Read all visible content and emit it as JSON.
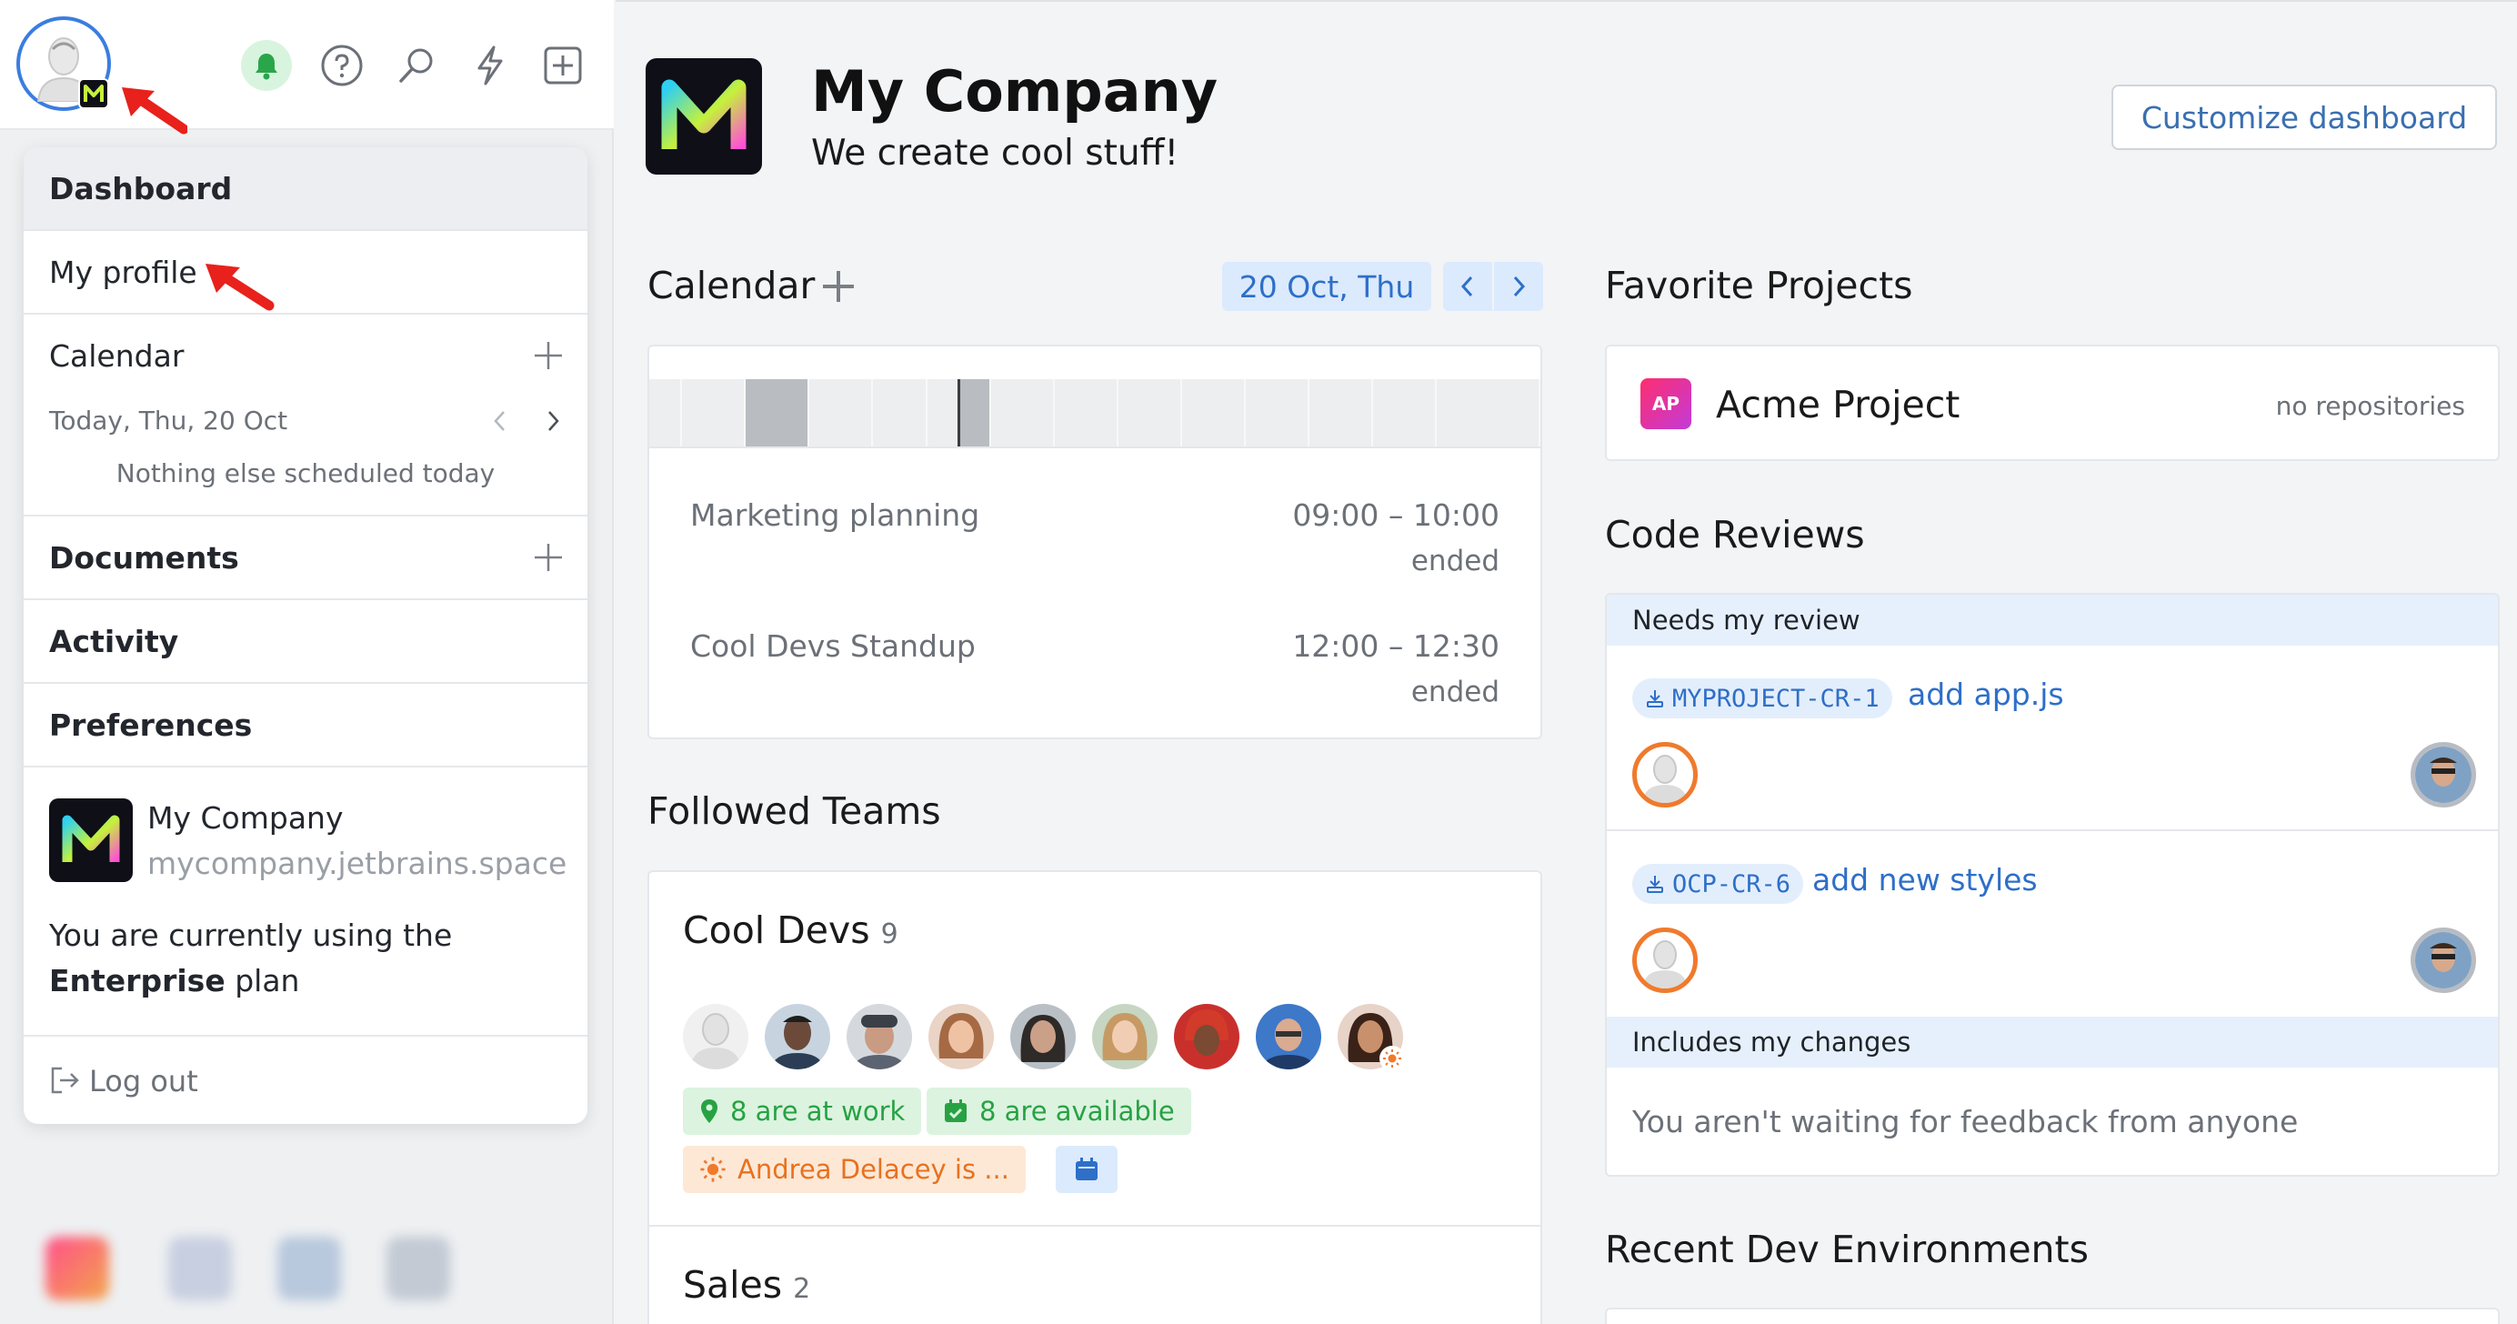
{
  "sidebar": {
    "menu": {
      "dashboard": "Dashboard",
      "my_profile": "My profile",
      "calendar": "Calendar",
      "calendar_today": "Today, Thu, 20 Oct",
      "calendar_empty": "Nothing else scheduled today",
      "documents": "Documents",
      "activity": "Activity",
      "preferences": "Preferences",
      "org_name": "My Company",
      "org_url": "mycompany.jetbrains.space",
      "plan_prefix": "You are currently using the",
      "plan_name": "Enterprise",
      "plan_suffix": "plan",
      "logout": "Log out"
    }
  },
  "header": {
    "title": "My Company",
    "subtitle": "We create cool stuff!",
    "customize": "Customize dashboard"
  },
  "calendar": {
    "title": "Calendar",
    "date": "20 Oct, Thu",
    "events": [
      {
        "title": "Marketing planning",
        "time": "09:00 – 10:00",
        "status": "ended"
      },
      {
        "title": "Cool Devs Standup",
        "time": "12:00 – 12:30",
        "status": "ended"
      }
    ]
  },
  "teams": {
    "title": "Followed Teams",
    "list": [
      {
        "name": "Cool Devs",
        "count": "9",
        "at_work": "8 are at work",
        "available": "8 are available",
        "absence": "Andrea Delacey is ..."
      },
      {
        "name": "Sales",
        "count": "2"
      }
    ]
  },
  "favorites": {
    "title": "Favorite Projects",
    "project": {
      "badge": "AP",
      "name": "Acme Project",
      "meta": "no repositories"
    }
  },
  "code_reviews": {
    "title": "Code Reviews",
    "needs_review": "Needs my review",
    "items": [
      {
        "id": "MYPROJECT-CR-1",
        "title": "add app.js"
      },
      {
        "id": "OCP-CR-6",
        "title": "add new styles"
      }
    ],
    "includes_changes": "Includes my changes",
    "empty": "You aren't waiting for feedback from anyone"
  },
  "dev_envs": {
    "title": "Recent Dev Environments"
  }
}
